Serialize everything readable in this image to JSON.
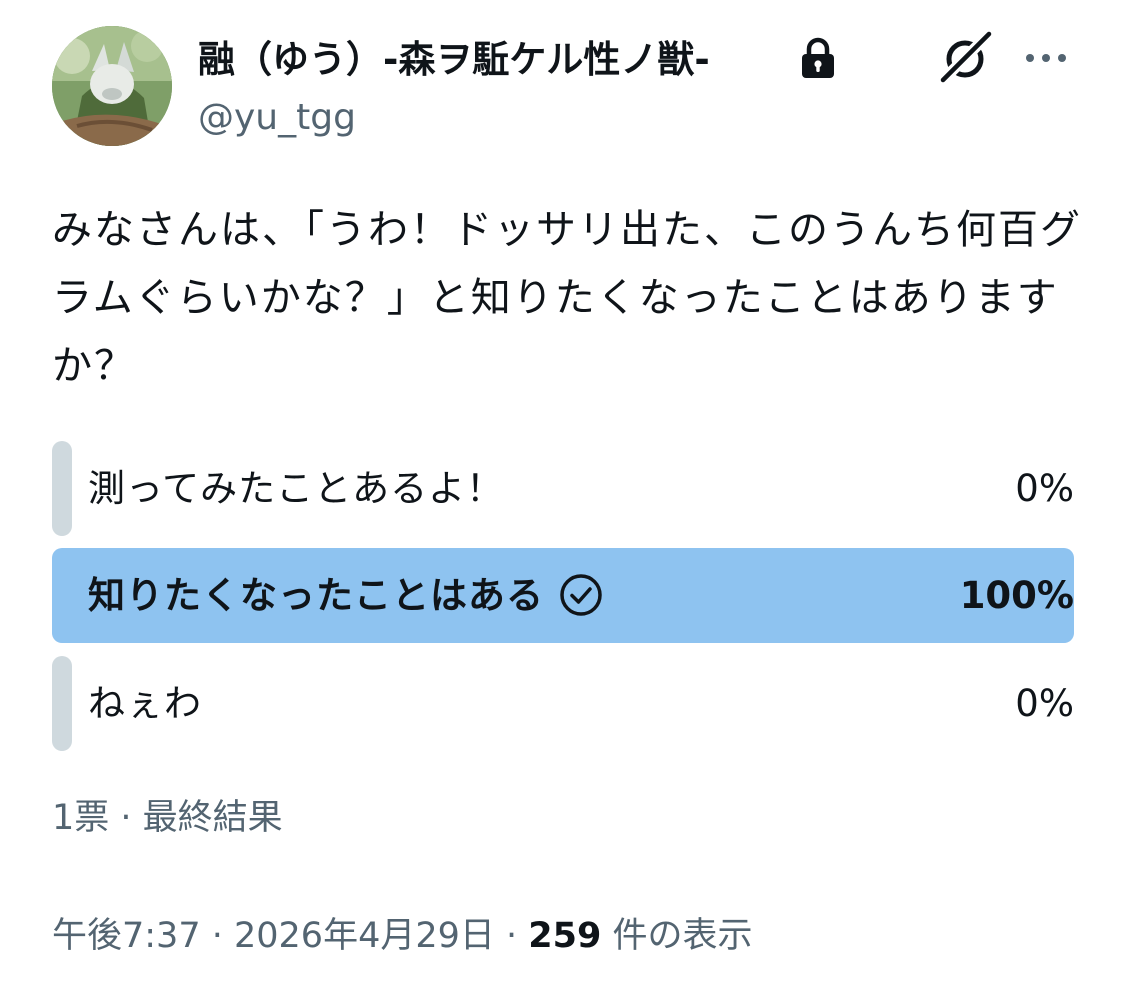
{
  "author": {
    "display_name": "融（ゆう）-森ヲ駈ケル性ノ獣-",
    "handle": "@yu_tgg",
    "protected_icon": "lock-icon"
  },
  "header_icons": {
    "grok": "grok-icon",
    "more": "more-icon"
  },
  "tweet": {
    "text": "みなさんは、「うわ！ドッサリ出た、このうんち何百グラムぐらいかな？」と知りたくなったことはありますか？"
  },
  "poll": {
    "options": [
      {
        "label": "測ってみたことあるよ！",
        "percent_text": "0%",
        "fraction": 0.0,
        "selected": false
      },
      {
        "label": "知りたくなったことはある",
        "percent_text": "100%",
        "fraction": 1.0,
        "selected": true
      },
      {
        "label": "ねぇわ",
        "percent_text": "0%",
        "fraction": 0.0,
        "selected": false
      }
    ],
    "footer": "1票 · 最終結果"
  },
  "meta": {
    "time": "午後7:37",
    "separator": " · ",
    "date": "2026年4月29日",
    "views_count": "259",
    "views_suffix": " 件の表示"
  },
  "colors": {
    "winner_bar": "#8ec3f0",
    "loser_bar": "#cfd9de",
    "secondary_text": "#536471",
    "primary_text": "#0f1419"
  }
}
